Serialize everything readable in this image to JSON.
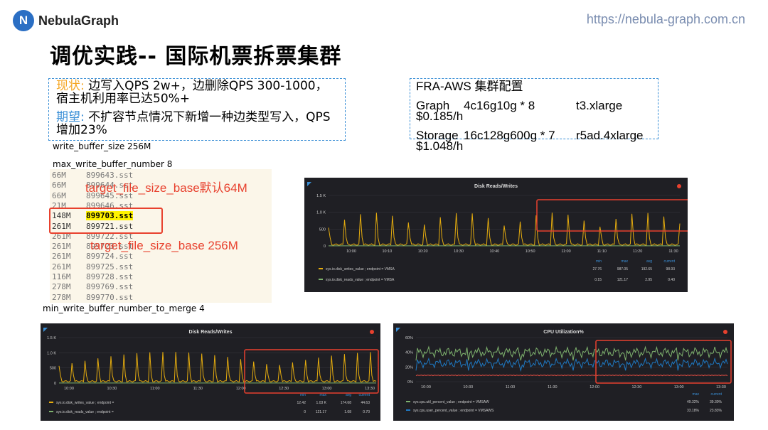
{
  "header": {
    "logo_mark": "N",
    "logo_text": "NebulaGraph",
    "url": "https://nebula-graph.com.cn"
  },
  "title": "调优实践-- 国际机票拆票集群",
  "status_box": {
    "now_label": "现状:",
    "now_text": "边写入QPS 2w+，边删除QPS 300-1000，",
    "now_text2": "宿主机利用率已达50%+",
    "goal_label": "期望:",
    "goal_text": "不扩容节点情况下新增一种边类型写入，QPS",
    "goal_text2": "增加23%"
  },
  "cluster_config": {
    "heading": "FRA-AWS 集群配置",
    "rows": [
      {
        "role": "Graph",
        "spec": "4c16g10g * 8",
        "instance": "t3.xlarge",
        "price": "$0.185/h"
      },
      {
        "role": "Storage",
        "spec": "16c128g600g * 7",
        "instance": "r5ad.4xlarge",
        "price": "$1.048/h"
      }
    ]
  },
  "params": {
    "write_buffer_size": "write_buffer_size  256M",
    "max_write_buffer_number": "max_write_buffer_number 8",
    "min_write_buffer_number_to_merge": "min_write_buffer_number_to_merge  4"
  },
  "sst_files": [
    {
      "size": "66M",
      "file": "899643.sst"
    },
    {
      "size": "66M",
      "file": "899644.sst"
    },
    {
      "size": "66M",
      "file": "899645.sst"
    },
    {
      "size": "21M",
      "file": "899646.sst"
    },
    {
      "size": "148M",
      "file": "899703.sst"
    },
    {
      "size": "261M",
      "file": "899721.sst"
    },
    {
      "size": "261M",
      "file": "899722.sst"
    },
    {
      "size": "261M",
      "file": "899723.sst"
    },
    {
      "size": "261M",
      "file": "899724.sst"
    },
    {
      "size": "261M",
      "file": "899725.sst"
    },
    {
      "size": "116M",
      "file": "899728.sst"
    },
    {
      "size": "278M",
      "file": "899769.sst"
    },
    {
      "size": "278M",
      "file": "899770.sst"
    }
  ],
  "annotations": {
    "default": "target_file_size_base默认64M",
    "tuned": "target_file_size_base 256M"
  },
  "colors": {
    "accent_orange": "#f5a623",
    "accent_blue": "#3a8fd6",
    "highlight_red": "#e8412e",
    "panel_bg": "#1f1f24",
    "series_yellow": "#e5ac0e",
    "series_green": "#7eb26d",
    "series_blue": "#1f78c1",
    "series_red": "#e24d42"
  },
  "chart_data": [
    {
      "type": "line",
      "title": "Disk Reads/Writes",
      "y_ticks": [
        "1.5 K",
        "1.0 K",
        "500",
        "0"
      ],
      "x_ticks": [
        "10:00",
        "10:10",
        "10:20",
        "10:30",
        "10:40",
        "10:50",
        "11:00",
        "11:10",
        "11:20",
        "11:30"
      ],
      "ylim": [
        0,
        1500
      ],
      "legend_headers": [
        "min",
        "max",
        "avg",
        "current"
      ],
      "series": [
        {
          "name": "sys.io.disk_writes_value ; endpoint = VMSA",
          "color": "#e5ac0e",
          "style": "spikes",
          "peak": 987.05,
          "baseline": 40,
          "stats": [
            "27.76",
            "987.05",
            "192.65",
            "98.93"
          ]
        },
        {
          "name": "sys.io.disk_reads_value ; endpoint = VMSA",
          "color": "#7eb26d",
          "style": "flat",
          "peak": 0,
          "baseline": 2,
          "stats": [
            "0.15",
            "121.17",
            "2.95",
            "0.40"
          ]
        }
      ]
    },
    {
      "type": "line",
      "title": "Disk Reads/Writes",
      "y_ticks": [
        "1.5 K",
        "1.0 K",
        "500",
        "0"
      ],
      "x_ticks": [
        "10:00",
        "10:30",
        "11:00",
        "11:30",
        "12:00",
        "12:30",
        "13:00",
        "13:30"
      ],
      "ylim": [
        0,
        1500
      ],
      "legend_headers": [
        "min",
        "max",
        "avg",
        "current"
      ],
      "series": [
        {
          "name": "sys.io.disk_writes_value ; endpoint =",
          "color": "#e5ac0e",
          "style": "spikes",
          "peak": 1030,
          "baseline": 60,
          "stats": [
            "12.42",
            "1.03 K",
            "174.68",
            "44.63"
          ]
        },
        {
          "name": "sys.io.disk_reads_value ; endpoint =",
          "color": "#7eb26d",
          "style": "flat",
          "peak": 0,
          "baseline": 2,
          "stats": [
            "0",
            "121.17",
            "1.68",
            "0.70"
          ]
        }
      ]
    },
    {
      "type": "line",
      "title": "CPU Utilization%",
      "y_ticks": [
        "60%",
        "40%",
        "20%",
        "0%"
      ],
      "x_ticks": [
        "10:00",
        "10:30",
        "11:00",
        "11:30",
        "12:00",
        "12:30",
        "13:00",
        "13:30"
      ],
      "ylim": [
        0,
        60
      ],
      "legend_headers": [
        "max",
        "current"
      ],
      "series": [
        {
          "name": "sys.cpu.util_percent_value ; endpoint = VMSAW",
          "color": "#7eb26d",
          "style": "noisy",
          "peak": 49.32,
          "baseline": 40,
          "stats": [
            "49.32%",
            "39.30%"
          ]
        },
        {
          "name": "sys.cpu.user_percent_value ; endpoint = VMSAWS",
          "color": "#1f78c1",
          "style": "noisy",
          "peak": 33.18,
          "baseline": 25,
          "stats": [
            "33.18%",
            "23.83%"
          ]
        },
        {
          "name": "",
          "color": "#e24d42",
          "style": "flat",
          "peak": 0,
          "baseline": 8,
          "stats": []
        }
      ]
    }
  ]
}
